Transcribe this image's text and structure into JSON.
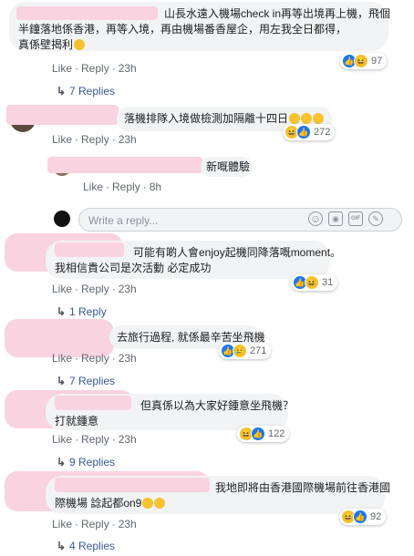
{
  "comments": [
    {
      "id": "c1",
      "text_line1": "山長水遠入機場check in再等出境再上機，飛個",
      "text_line2": "半鐘落地係香港，再等入境，再由機場番香屋企，用左我全日都得，",
      "text_line3": "真係壁揭利",
      "actions": {
        "like": "Like",
        "reply": "Reply",
        "time": "23h"
      },
      "reaction_count": "97",
      "replies_label": "7 Replies"
    },
    {
      "id": "c2",
      "text_line1": "落機排隊入境做檢測加隔離十四日",
      "actions": {
        "like": "Like",
        "reply": "Reply",
        "time": "23h"
      },
      "reaction_count": "272"
    },
    {
      "id": "c2r1",
      "text_line1": "新嘅體驗",
      "actions": {
        "like": "Like",
        "reply": "Reply",
        "time": "8h"
      }
    },
    {
      "id": "c3",
      "text_line1": "可能有啲人會enjoy起機同降落嘅moment。",
      "text_line2": "我相信貴公司是次活動 必定成功",
      "actions": {
        "like": "Like",
        "reply": "Reply",
        "time": "23h"
      },
      "reaction_count": "31",
      "replies_label": "1 Reply"
    },
    {
      "id": "c4",
      "text_line1": "去旅行過程, 就係最辛苦坐飛機",
      "actions": {
        "like": "Like",
        "reply": "Reply",
        "time": "23h"
      },
      "reaction_count": "271",
      "replies_label": "7 Replies"
    },
    {
      "id": "c5",
      "text_line1": "但真係以為大家好鍾意坐飛機？",
      "text_line2": "打就鍾意",
      "actions": {
        "like": "Like",
        "reply": "Reply",
        "time": "23h"
      },
      "reaction_count": "122",
      "replies_label": "9 Replies"
    },
    {
      "id": "c6",
      "text_line1": "我地即將由香港國際機場前往香港國",
      "text_line2": "際機場 諗起都on9",
      "actions": {
        "like": "Like",
        "reply": "Reply",
        "time": "23h"
      },
      "reaction_count": "92",
      "replies_label": "4 Replies"
    }
  ],
  "composer": {
    "placeholder": "Write a reply..."
  },
  "icons": {
    "emoji": "smiley-icon",
    "camera": "camera-icon",
    "gif": "gif-icon",
    "sticker": "sticker-icon",
    "reply_arrow": "reply-arrow-icon"
  },
  "colors": {
    "link": "#385898",
    "like_blue": "#1877f2",
    "bubble": "#f2f3f5"
  }
}
